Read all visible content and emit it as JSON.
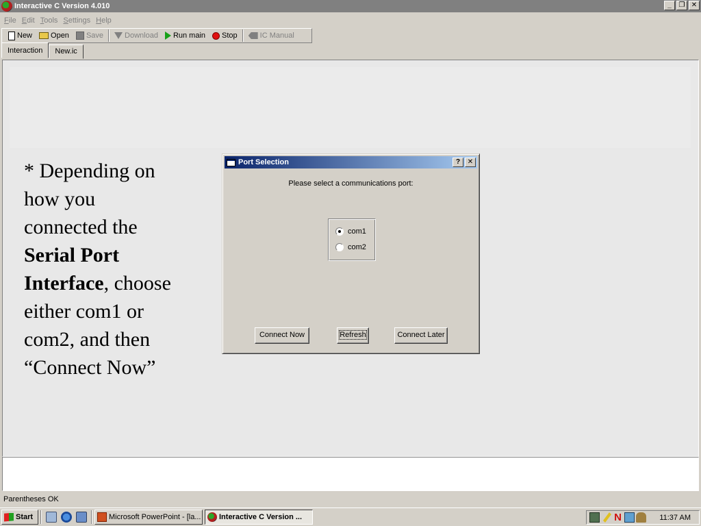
{
  "window": {
    "title": "Interactive C Version 4.010",
    "controls": {
      "minimize": "_",
      "restore": "❐",
      "close": "✕"
    }
  },
  "menu": [
    {
      "key": "F",
      "rest": "ile"
    },
    {
      "key": "E",
      "rest": "dit"
    },
    {
      "key": "T",
      "rest": "ools"
    },
    {
      "key": "S",
      "rest": "ettings"
    },
    {
      "key": "H",
      "rest": "elp"
    }
  ],
  "toolbar": {
    "new": "New",
    "open": "Open",
    "save": "Save",
    "download": "Download",
    "run_main": "Run main",
    "stop": "Stop",
    "ic_manual": "IC Manual"
  },
  "tabs": {
    "interaction": "Interaction",
    "file": "New.ic"
  },
  "slide": {
    "line1": "* Depending on",
    "line2": "how you",
    "line3": "connected the",
    "bold1": "Serial Port",
    "bold2": "Interface",
    "after_bold": ", choose",
    "line5": "either com1 or",
    "line6": "com2, and then",
    "line7": "“Connect Now”"
  },
  "dialog": {
    "title": "Port Selection",
    "help": "?",
    "close": "✕",
    "prompt": "Please select a communications port:",
    "options": [
      "com1",
      "com2"
    ],
    "selected": "com1",
    "buttons": {
      "connect_now": "Connect Now",
      "refresh": "Refresh",
      "connect_later": "Connect Later"
    }
  },
  "status": "Parentheses OK",
  "taskbar": {
    "start": "Start",
    "tasks": [
      "Microsoft PowerPoint - [la...",
      "Interactive C Version ..."
    ],
    "clock": "11:37 AM"
  },
  "icons": {
    "app": "interactive-c-icon",
    "new": "new-document-icon",
    "open": "open-folder-icon",
    "save": "save-disk-icon",
    "download": "download-arrow-icon",
    "run": "play-triangle-icon",
    "stop": "stop-circle-icon",
    "manual": "manual-icon"
  },
  "colors": {
    "dialog_title_start": "#0a246a",
    "dialog_title_end": "#a6caf0",
    "run": "#18a018",
    "stop": "#e01010"
  }
}
